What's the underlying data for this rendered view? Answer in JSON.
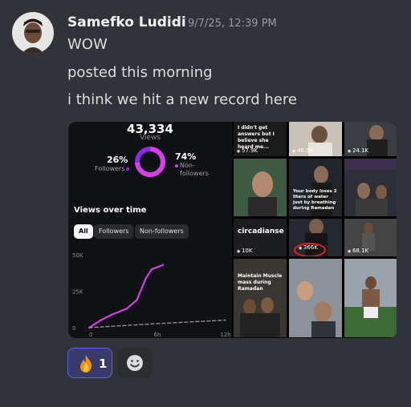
{
  "message": {
    "author": "Samefko Ludidi",
    "timestamp": "9/7/25, 12:39 PM",
    "lines": [
      "WOW",
      "posted this morning",
      "i think we hit a new record here"
    ]
  },
  "insights": {
    "total_views": "43,334",
    "views_label": "Views",
    "followers_pct": "26%",
    "followers_label": "Followers",
    "nonfollowers_pct": "74%",
    "nonfollowers_label_1": "Non-",
    "nonfollowers_label_2": "followers",
    "section_title": "Views over time",
    "filters": [
      "All",
      "Followers",
      "Non-followers"
    ],
    "active_filter": "All"
  },
  "chart_data": {
    "type": "line",
    "xlabel": "",
    "ylabel": "",
    "x_ticks": [
      "0",
      "6h",
      "12h"
    ],
    "y_ticks": [
      "50K",
      "25K",
      "0"
    ],
    "ylim": [
      0,
      50000
    ],
    "xlim": [
      0,
      12
    ],
    "series": [
      {
        "values": [
          [
            0,
            0
          ],
          [
            1,
            5000
          ],
          [
            2,
            9000
          ],
          [
            3.3,
            13000
          ],
          [
            4.2,
            19000
          ],
          [
            5,
            34000
          ],
          [
            5.5,
            40000
          ],
          [
            6.5,
            43000
          ]
        ],
        "color": "#d63fe8"
      },
      {
        "values": [
          [
            0,
            0
          ],
          [
            6,
            2800
          ],
          [
            12,
            5200
          ]
        ],
        "color": "#8e8e93",
        "dashed": true
      }
    ]
  },
  "reels": [
    {
      "count": "57.9K",
      "text": "I didn't get answers but I believe she heard me...",
      "bg": "#1a1a1a"
    },
    {
      "count": "48.5K",
      "text": "",
      "bg": "#c8c2b8"
    },
    {
      "count": "24.1K",
      "text": "",
      "bg": "#3a3d42"
    },
    {
      "count": "",
      "text": "",
      "bg": "#2f3c32"
    },
    {
      "count": "",
      "text": "Your body loses 2 liters of water just by breathing during Ramadan",
      "bg": "#22262c"
    },
    {
      "count": "",
      "text": "",
      "bg": "#2c2f38"
    },
    {
      "count": "10K",
      "text": "circadianse",
      "bg": "#1c1d20"
    },
    {
      "count": "366K",
      "text": "",
      "bg": "#252830"
    },
    {
      "count": "68.1K",
      "text": "",
      "bg": "#3a3a3a"
    },
    {
      "count": "",
      "text": "Maintain Muscle mass during Ramadan",
      "bg": "#4a4640"
    },
    {
      "count": "",
      "text": "",
      "bg": "#6e6558"
    },
    {
      "count": "",
      "text": "",
      "bg": "#7d8790"
    }
  ],
  "reaction": {
    "emoji": "fire-emoji",
    "count": "1"
  },
  "colors": {
    "background": "#323339",
    "accent": "#5865f2",
    "chart_pink": "#d63fe8",
    "circle_red": "#e51e1e"
  }
}
